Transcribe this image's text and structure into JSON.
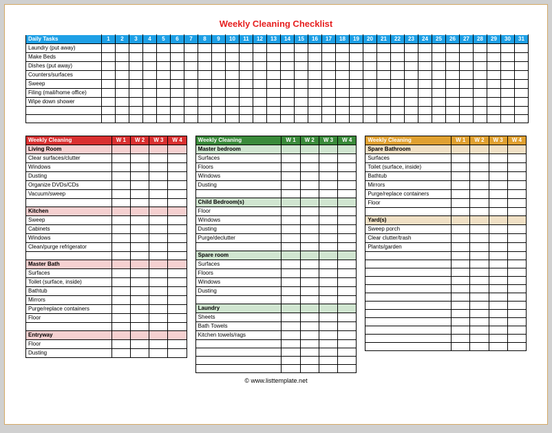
{
  "title": "Weekly Cleaning Checklist",
  "daily": {
    "header": "Daily Tasks",
    "days": [
      "1",
      "2",
      "3",
      "4",
      "5",
      "6",
      "7",
      "8",
      "9",
      "10",
      "11",
      "12",
      "13",
      "14",
      "15",
      "16",
      "17",
      "18",
      "19",
      "20",
      "21",
      "22",
      "23",
      "24",
      "25",
      "26",
      "27",
      "28",
      "29",
      "30",
      "31"
    ],
    "tasks": [
      "Laundry (put away)",
      "Make Beds",
      "Dishes (put away)",
      "Counters/surfaces",
      "Sweep",
      "Filing (mail/home office)",
      "Wipe down shower"
    ],
    "blank_rows": 2
  },
  "weekly_header_label": "Weekly Cleaning",
  "weekly_cols": [
    "W 1",
    "W 2",
    "W 3",
    "W 4"
  ],
  "columns": [
    {
      "color": "red",
      "sections": [
        {
          "title": "Living Room",
          "items": [
            "Clear surfaces/clutter",
            "Windows",
            "Dusting",
            "Organize DVDs/CDs",
            "Vacuum/sweep"
          ],
          "blank_after": 1
        },
        {
          "title": "Kitchen",
          "items": [
            "Sweep",
            "Cabinets",
            "Windows",
            "Clean/purge refrigerator"
          ],
          "blank_after": 1
        },
        {
          "title": "Master Bath",
          "items": [
            "Surfaces",
            "Toilet (surface, inside)",
            "Bathtub",
            "Mirrors",
            "Purge/replace containers",
            "Floor"
          ],
          "blank_after": 1
        },
        {
          "title": "Entryway",
          "items": [
            "Floor",
            "Dusting"
          ],
          "blank_after": 0
        }
      ],
      "trailing_blank": 0
    },
    {
      "color": "green",
      "sections": [
        {
          "title": "Master bedroom",
          "items": [
            "Surfaces",
            "Floors",
            "Windows",
            "Dusting"
          ],
          "blank_after": 1
        },
        {
          "title": "Child Bedroom(s)",
          "items": [
            "Floor",
            "Windows",
            "Dusting",
            "Purge/declutter"
          ],
          "blank_after": 1
        },
        {
          "title": "Spare room",
          "items": [
            "Surfaces",
            "Floors",
            "Windows",
            "Dusting"
          ],
          "blank_after": 1
        },
        {
          "title": "Laundry",
          "items": [
            "Sheets",
            "Bath Towels",
            "Kitchen towels/rags"
          ],
          "blank_after": 0
        }
      ],
      "trailing_blank": 4
    },
    {
      "color": "gold",
      "sections": [
        {
          "title": "Spare Bathroom",
          "items": [
            "Surfaces",
            "Toilet (surface, inside)",
            "Bathtub",
            "Mirrors",
            "Purge/replace containers",
            "Floor"
          ],
          "blank_after": 1
        },
        {
          "title": "Yard(s)",
          "items": [
            "Sweep porch",
            "Clear clutter/trash",
            "Plants/garden"
          ],
          "blank_after": 0
        }
      ],
      "trailing_blank": 12
    }
  ],
  "footer": "© www.listtemplate.net"
}
